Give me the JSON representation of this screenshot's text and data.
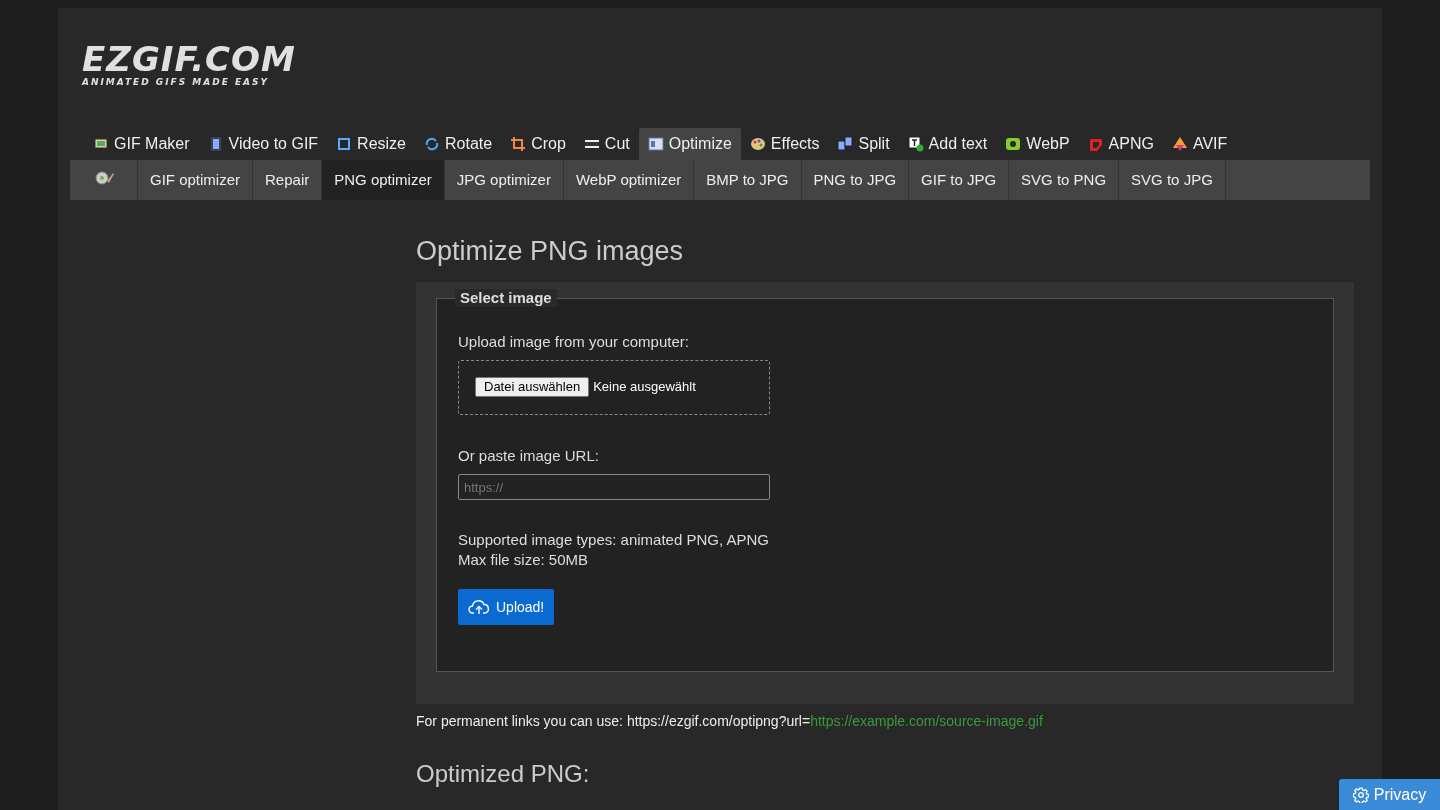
{
  "logo": {
    "title": "EZGIF.COM",
    "tagline": "ANIMATED GIFS MADE EASY"
  },
  "main_nav": [
    {
      "label": "GIF Maker",
      "selected": false
    },
    {
      "label": "Video to GIF",
      "selected": false
    },
    {
      "label": "Resize",
      "selected": false
    },
    {
      "label": "Rotate",
      "selected": false
    },
    {
      "label": "Crop",
      "selected": false
    },
    {
      "label": "Cut",
      "selected": false
    },
    {
      "label": "Optimize",
      "selected": true
    },
    {
      "label": "Effects",
      "selected": false
    },
    {
      "label": "Split",
      "selected": false
    },
    {
      "label": "Add text",
      "selected": false
    },
    {
      "label": "WebP",
      "selected": false
    },
    {
      "label": "APNG",
      "selected": false
    },
    {
      "label": "AVIF",
      "selected": false
    }
  ],
  "sub_nav": [
    {
      "label": "GIF optimizer",
      "selected": false
    },
    {
      "label": "Repair",
      "selected": false
    },
    {
      "label": "PNG optimizer",
      "selected": true
    },
    {
      "label": "JPG optimizer",
      "selected": false
    },
    {
      "label": "WebP optimizer",
      "selected": false
    },
    {
      "label": "BMP to JPG",
      "selected": false
    },
    {
      "label": "PNG to JPG",
      "selected": false
    },
    {
      "label": "GIF to JPG",
      "selected": false
    },
    {
      "label": "SVG to PNG",
      "selected": false
    },
    {
      "label": "SVG to JPG",
      "selected": false
    }
  ],
  "heading": "Optimize PNG images",
  "form": {
    "legend": "Select image",
    "upload_label": "Upload image from your computer:",
    "file_button": "Datei auswählen",
    "file_status": "Keine ausgewählt",
    "url_label": "Or paste image URL:",
    "url_placeholder": "https://",
    "supported": "Supported image types: animated PNG, APNG",
    "max_size": "Max file size: 50MB",
    "upload_button": "Upload!"
  },
  "permanent_link": {
    "text": "For permanent links you can use: https://ezgif.com/optipng?url=",
    "link": "https://example.com/source-image.gif"
  },
  "result_heading": "Optimized PNG:",
  "privacy_button": "Privacy"
}
